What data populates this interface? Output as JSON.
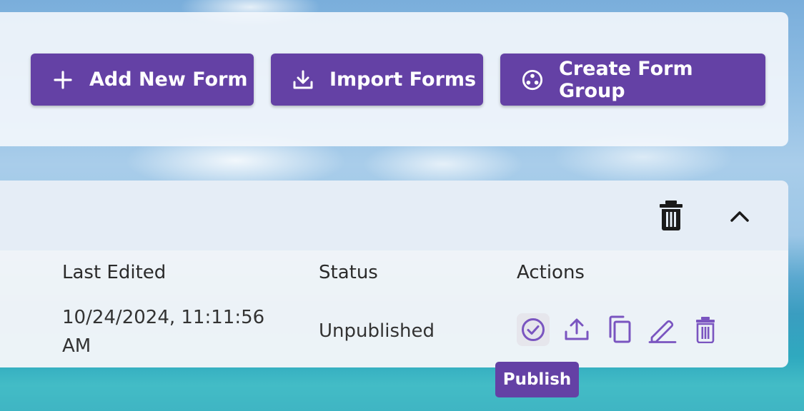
{
  "toolbar": {
    "add_new_form": {
      "label": "Add New Form",
      "icon": "plus-icon"
    },
    "import_forms": {
      "label": "Import Forms",
      "icon": "download-icon"
    },
    "create_form_group": {
      "label": "Create Form Group",
      "icon": "group-circle-icon"
    }
  },
  "table": {
    "header_actions": {
      "delete_icon": "trash-icon",
      "collapse_icon": "chevron-up-icon"
    },
    "columns": [
      "Last Edited",
      "Status",
      "Actions"
    ],
    "rows": [
      {
        "last_edited": "10/24/2024, 11:11:56 AM",
        "status": "Unpublished",
        "actions": [
          "publish-icon",
          "export-icon",
          "copy-icon",
          "edit-icon",
          "delete-icon"
        ]
      }
    ]
  },
  "tooltip": {
    "text": "Publish"
  },
  "colors": {
    "accent": "#6441a5",
    "action_icon": "#7a55c0",
    "text": "#333333"
  }
}
